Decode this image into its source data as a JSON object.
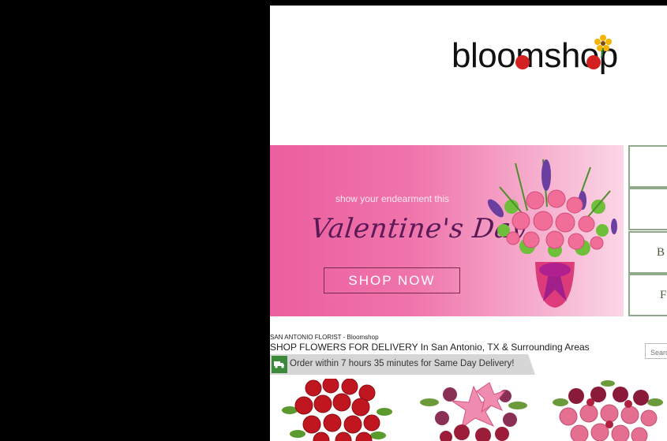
{
  "logo": {
    "text": "bloomshop"
  },
  "banner": {
    "tagline": "show your endearment this",
    "headline": "Valentine's Day",
    "cta": "SHOP NOW"
  },
  "side_nav": {
    "letters": [
      "",
      "",
      "B",
      "F"
    ]
  },
  "breadcrumb": "SAN ANTONIO FLORIST - Bloomshop",
  "heading": "SHOP FLOWERS FOR DELIVERY In San Antonio, TX & Surrounding Areas",
  "search": {
    "placeholder": "Search"
  },
  "delivery": {
    "message": "Order within 7 hours 35 minutes for Same Day Delivery!"
  },
  "products": [
    {
      "icon": "red-roses-bouquet-image"
    },
    {
      "icon": "pink-lily-bouquet-image"
    },
    {
      "icon": "mixed-rose-bouquet-image"
    }
  ],
  "colors": {
    "brand_green": "#3a8a3a",
    "banner_pink": "#ec5e9f",
    "nav_border": "#8fa98a",
    "headline": "#5a1a57"
  }
}
